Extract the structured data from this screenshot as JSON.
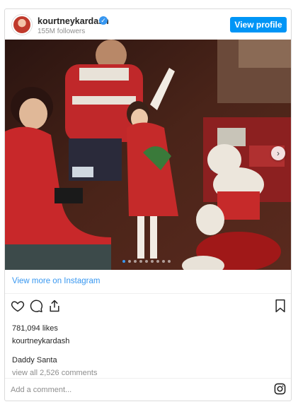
{
  "header": {
    "username": "kourtneykardash",
    "followers": "155M followers",
    "view_profile_label": "View profile",
    "verified_glyph": "✓"
  },
  "photo": {
    "description_icon": "photo",
    "carousel_count": 9,
    "carousel_active": 1,
    "next_glyph": "›"
  },
  "view_more": "View more on Instagram",
  "actions": {
    "like_icon": "heart-icon",
    "comment_icon": "comment-icon",
    "share_icon": "share-icon",
    "save_icon": "bookmark-icon"
  },
  "likes": "781,094 likes",
  "owner": "kourtneykardash",
  "caption": "Daddy Santa",
  "comments_link": "view all 2,526 comments",
  "comment_placeholder": "Add a comment...",
  "colors": {
    "accent": "#3897f0",
    "button": "#0095f6"
  }
}
